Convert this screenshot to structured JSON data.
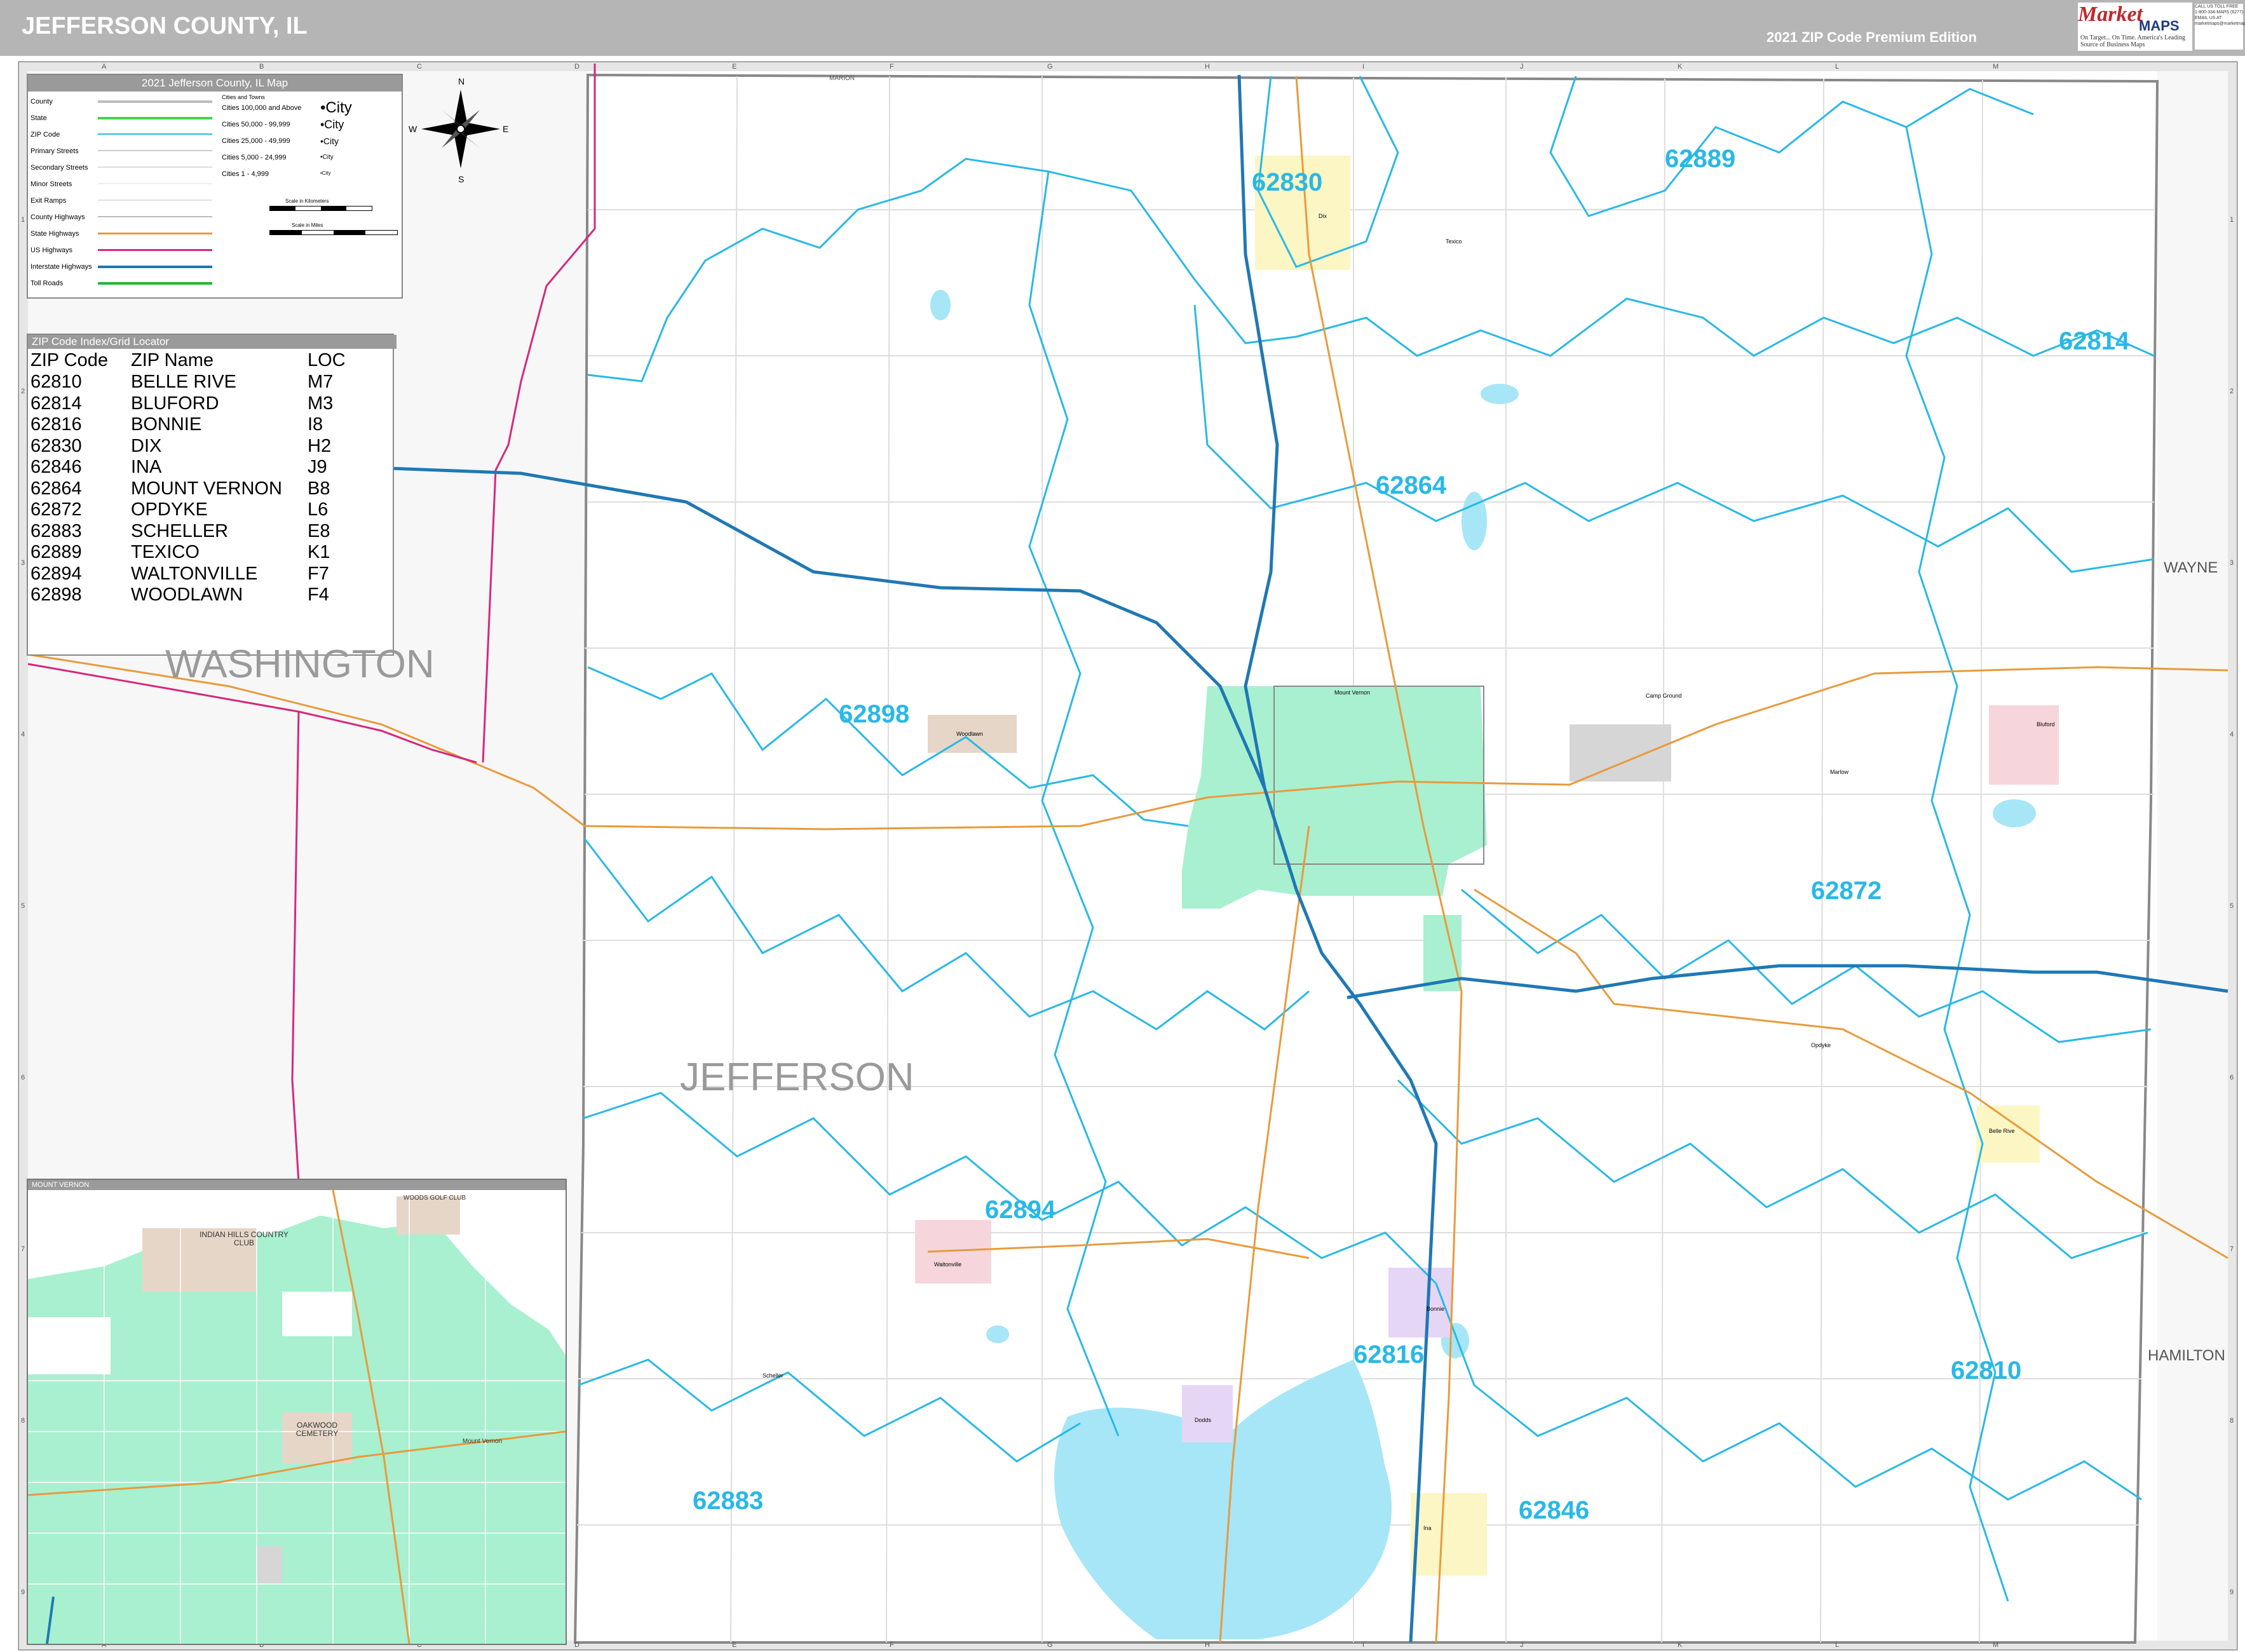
{
  "header": {
    "title": "JEFFERSON COUNTY, IL",
    "edition": "2021 ZIP Code Premium Edition"
  },
  "logo": {
    "brand_top": "Market",
    "brand_bottom": "MAPS",
    "tagline": "On Target... On Time. America's Leading Source of Business Maps",
    "contact": [
      "CALL US TOLL FREE",
      "1-800-334-MAPS (6277)",
      "EMAIL US AT",
      "marketmaps@marketmapsinc.com"
    ]
  },
  "colors": {
    "zip_boundary": "#29b8e6",
    "interstate": "#1f78b4",
    "us_highway": "#d6287b",
    "state_highway": "#e89a3c",
    "water": "#a6e6f7",
    "city_area": "#a8f0d0"
  },
  "legend": {
    "title": "2021 Jefferson County, IL Map",
    "rows": [
      "County",
      "State",
      "ZIP Code",
      "Primary Streets",
      "Secondary Streets",
      "Minor Streets",
      "Exit Ramps",
      "County Highways",
      "State Highways",
      "US Highways",
      "Interstate Highways",
      "Toll Roads"
    ],
    "cities_header": "Cities and Towns",
    "cities": [
      "Cities 100,000 and Above",
      "Cities 50,000 - 99,999",
      "Cities 25,000 - 49,999",
      "Cities 5,000 - 24,999",
      "Cities 1 - 4,999"
    ],
    "city_samples": [
      "•City",
      "•City",
      "•City",
      "•City",
      "•City"
    ],
    "scale_km": "Scale in Kilometers",
    "scale_mi": "Scale in Miles"
  },
  "compass": {
    "n": "N",
    "s": "S",
    "e": "E",
    "w": "W"
  },
  "zip_index": {
    "title": "ZIP Code Index/Grid Locator",
    "headers": [
      "ZIP Code",
      "ZIP Name",
      "LOC"
    ],
    "rows": [
      [
        "62810",
        "BELLE RIVE",
        "M7"
      ],
      [
        "62814",
        "BLUFORD",
        "M3"
      ],
      [
        "62816",
        "BONNIE",
        "I8"
      ],
      [
        "62830",
        "DIX",
        "H2"
      ],
      [
        "62846",
        "INA",
        "J9"
      ],
      [
        "62864",
        "MOUNT VERNON",
        "B8"
      ],
      [
        "62872",
        "OPDYKE",
        "L6"
      ],
      [
        "62883",
        "SCHELLER",
        "E8"
      ],
      [
        "62889",
        "TEXICO",
        "K1"
      ],
      [
        "62894",
        "WALTONVILLE",
        "F7"
      ],
      [
        "62898",
        "WOODLAWN",
        "F4"
      ]
    ]
  },
  "counties": {
    "main": "JEFFERSON",
    "west": "WASHINGTON",
    "east_1": "WAYNE",
    "east_2": "HAMILTON",
    "north": "MARION"
  },
  "zip_labels": [
    {
      "zip": "62830"
    },
    {
      "zip": "62889"
    },
    {
      "zip": "62814"
    },
    {
      "zip": "62864"
    },
    {
      "zip": "62898"
    },
    {
      "zip": "62872"
    },
    {
      "zip": "62894"
    },
    {
      "zip": "62816"
    },
    {
      "zip": "62810"
    },
    {
      "zip": "62846"
    },
    {
      "zip": "62883"
    }
  ],
  "grid_cols": [
    "A",
    "B",
    "C",
    "D",
    "E",
    "F",
    "G",
    "H",
    "I",
    "J",
    "K",
    "L",
    "M"
  ],
  "grid_rows": [
    "1",
    "2",
    "3",
    "4",
    "5",
    "6",
    "7",
    "8",
    "9"
  ],
  "towns": [
    "Dix",
    "Texico",
    "Bluford",
    "Woodlawn",
    "Mount Vernon",
    "Opdyke",
    "Belle Rive",
    "Waltonville",
    "Bonnie",
    "Ina",
    "Scheller",
    "Dodds",
    "Camp Ground",
    "Marlow"
  ],
  "inset": {
    "title": "MOUNT VERNON",
    "labels": [
      "INDIAN HILLS COUNTRY CLUB",
      "WOODS GOLF CLUB",
      "OAKWOOD CEMETERY",
      "Mount Vernon"
    ]
  }
}
